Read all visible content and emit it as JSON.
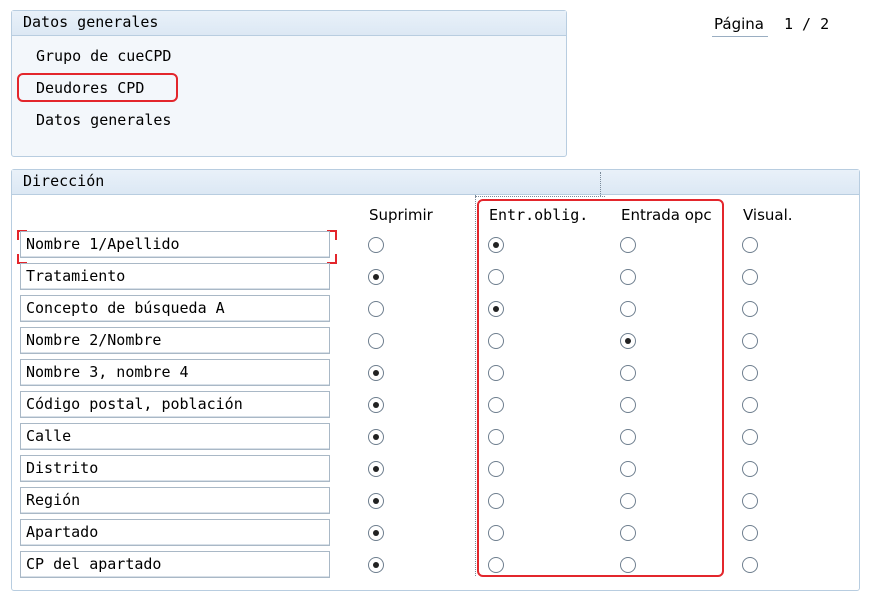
{
  "general": {
    "header": "Datos generales",
    "items": [
      "Grupo de cueCPD",
      "Deudores CPD",
      "Datos generales"
    ]
  },
  "page": {
    "label": "Página",
    "number": "1 / 2"
  },
  "direccion": {
    "header": "Dirección",
    "columns": [
      "Suprimir",
      "Entr.oblig.",
      "Entrada opc",
      "Visual."
    ],
    "rows": [
      {
        "label": "Nombre 1/Apellido",
        "selected": 1
      },
      {
        "label": "Tratamiento",
        "selected": 0
      },
      {
        "label": "Concepto de búsqueda A",
        "selected": 1
      },
      {
        "label": "Nombre 2/Nombre",
        "selected": 2
      },
      {
        "label": "Nombre 3, nombre 4",
        "selected": 0
      },
      {
        "label": "Código postal, población",
        "selected": 0
      },
      {
        "label": "Calle",
        "selected": 0
      },
      {
        "label": "Distrito",
        "selected": 0
      },
      {
        "label": "Región",
        "selected": 0
      },
      {
        "label": "Apartado",
        "selected": 0
      },
      {
        "label": "CP del apartado",
        "selected": 0
      }
    ]
  },
  "highlight_color": "#e3262c"
}
